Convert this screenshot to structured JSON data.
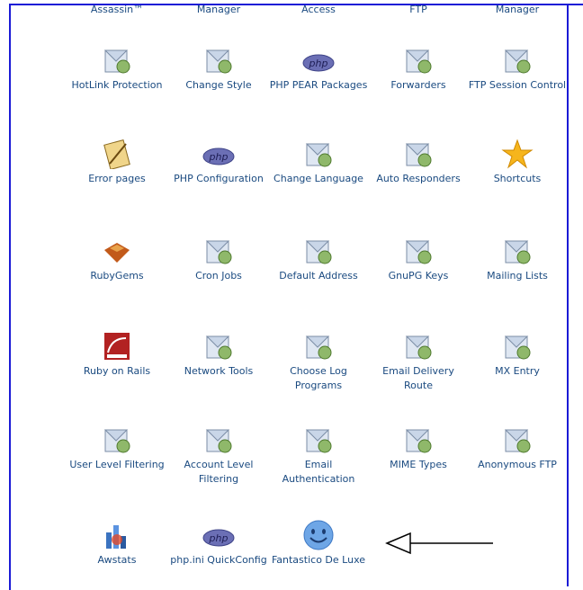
{
  "top_row": [
    "Assassin™",
    "Manager",
    "Access",
    "FTP",
    "Manager"
  ],
  "rows": [
    [
      {
        "label": "HotLink Protection",
        "icon": "hotlink-icon"
      },
      {
        "label": "Change Style",
        "icon": "change-style-icon"
      },
      {
        "label": "PHP PEAR Packages",
        "icon": "php-pear-icon"
      },
      {
        "label": "Forwarders",
        "icon": "forwarders-icon"
      },
      {
        "label": "FTP Session Control",
        "icon": "ftp-session-icon"
      }
    ],
    [
      {
        "label": "Error pages",
        "icon": "error-pages-icon"
      },
      {
        "label": "PHP Configuration",
        "icon": "php-config-icon"
      },
      {
        "label": "Change Language",
        "icon": "change-language-icon"
      },
      {
        "label": "Auto Responders",
        "icon": "auto-responders-icon"
      },
      {
        "label": "Shortcuts",
        "icon": "shortcuts-icon"
      }
    ],
    [
      {
        "label": "RubyGems",
        "icon": "rubygems-icon"
      },
      {
        "label": "Cron Jobs",
        "icon": "cron-jobs-icon"
      },
      {
        "label": "Default Address",
        "icon": "default-address-icon"
      },
      {
        "label": "GnuPG Keys",
        "icon": "gnupg-keys-icon"
      },
      {
        "label": "Mailing Lists",
        "icon": "mailing-lists-icon"
      }
    ],
    [
      {
        "label": "Ruby on Rails",
        "icon": "ruby-on-rails-icon"
      },
      {
        "label": "Network Tools",
        "icon": "network-tools-icon"
      },
      {
        "label": "Choose Log Programs",
        "icon": "choose-log-programs-icon"
      },
      {
        "label": "Email Delivery Route",
        "icon": "email-delivery-route-icon"
      },
      {
        "label": "MX Entry",
        "icon": "mx-entry-icon"
      }
    ],
    [
      {
        "label": "User Level Filtering",
        "icon": "user-level-filtering-icon"
      },
      {
        "label": "Account Level Filtering",
        "icon": "account-level-filtering-icon"
      },
      {
        "label": "Email Authentication",
        "icon": "email-authentication-icon"
      },
      {
        "label": "MIME Types",
        "icon": "mime-types-icon"
      },
      {
        "label": "Anonymous FTP",
        "icon": "anonymous-ftp-icon"
      }
    ],
    [
      {
        "label": "Awstats",
        "icon": "awstats-icon"
      },
      {
        "label": "php.ini QuickConfig",
        "icon": "php-ini-icon"
      },
      {
        "label": "Fantastico De Luxe",
        "icon": "fantastico-smiley-icon"
      }
    ]
  ],
  "php_badge_text": "php",
  "arrow_icon": "left-arrow-icon"
}
